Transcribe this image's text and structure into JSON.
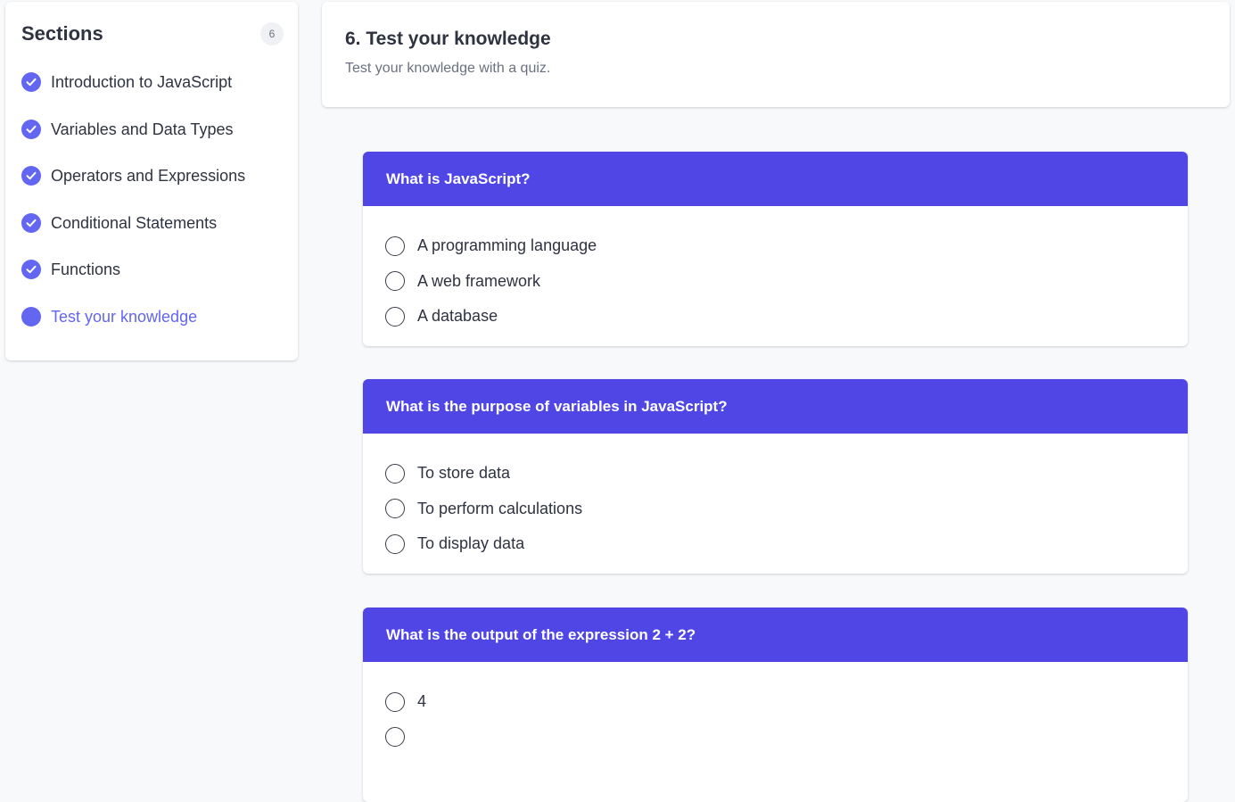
{
  "sidebar": {
    "title": "Sections",
    "count": "6",
    "items": [
      {
        "label": "Introduction to JavaScript",
        "status": "completed"
      },
      {
        "label": "Variables and Data Types",
        "status": "completed"
      },
      {
        "label": "Operators and Expressions",
        "status": "completed"
      },
      {
        "label": "Conditional Statements",
        "status": "completed"
      },
      {
        "label": "Functions",
        "status": "completed"
      },
      {
        "label": "Test your knowledge",
        "status": "current"
      }
    ]
  },
  "header": {
    "title": "6. Test your knowledge",
    "subtitle": "Test your knowledge with a quiz."
  },
  "quiz": {
    "questions": [
      {
        "text": "What is JavaScript?",
        "options": [
          "A programming language",
          "A web framework",
          "A database"
        ]
      },
      {
        "text": "What is the purpose of variables in JavaScript?",
        "options": [
          "To store data",
          "To perform calculations",
          "To display data"
        ]
      },
      {
        "text": "What is the output of the expression 2 + 2?",
        "options": [
          "4"
        ]
      }
    ]
  },
  "colors": {
    "accent": "#6366f1",
    "question_header": "#4f46e5",
    "background": "#f8f9fb"
  },
  "icons": {
    "completed": "check-circle-icon",
    "current": "filled-circle-icon",
    "option": "radio-icon"
  }
}
